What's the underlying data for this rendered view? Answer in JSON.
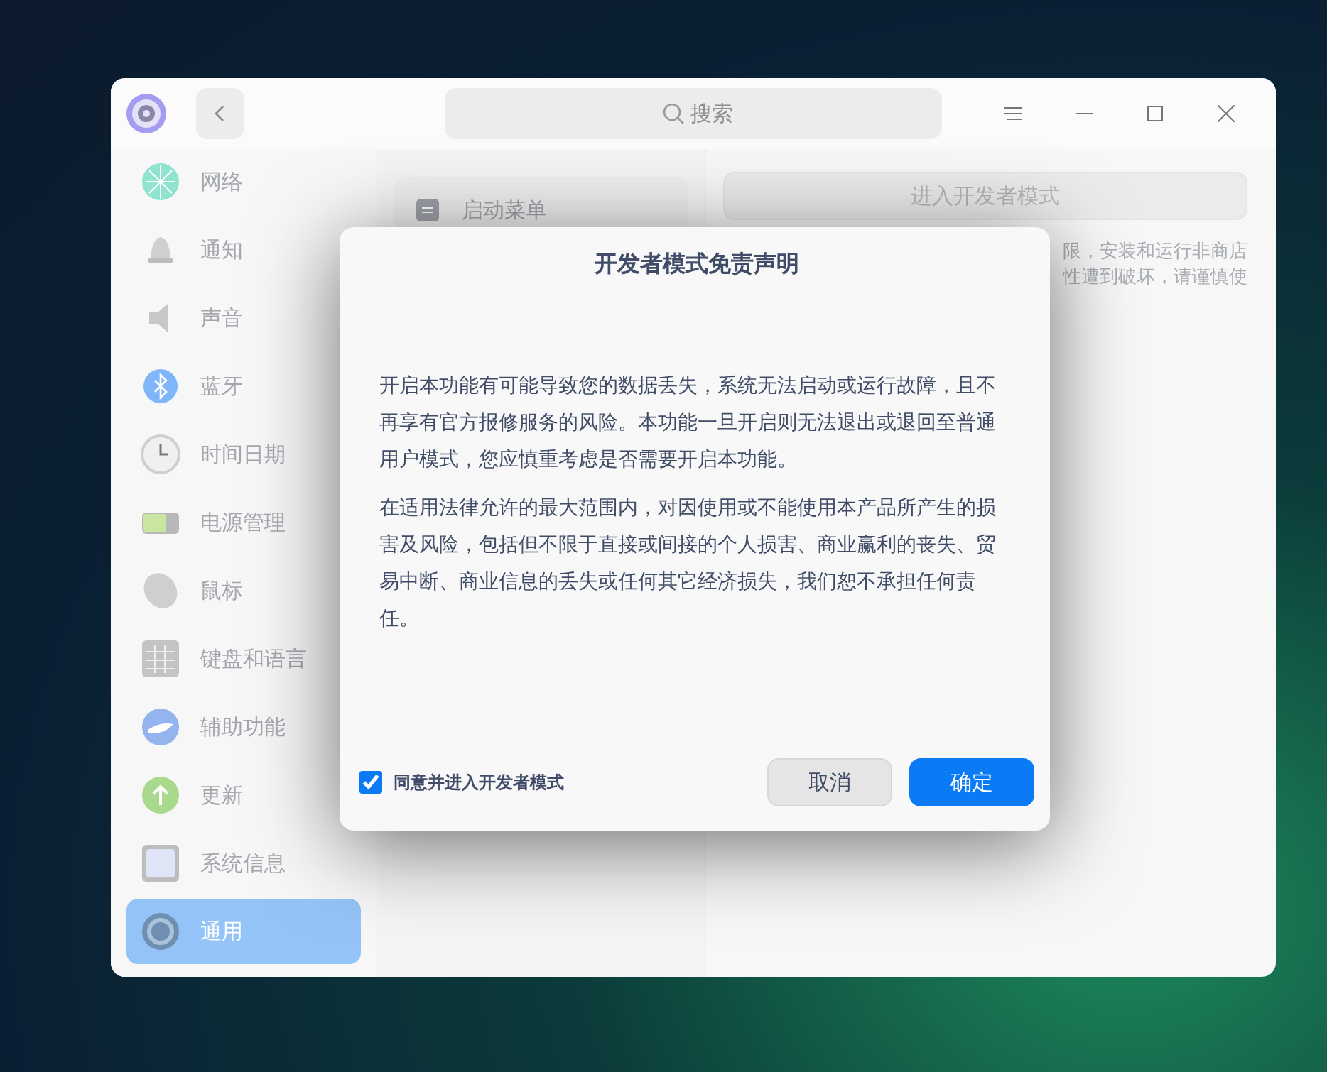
{
  "window": {
    "search": {
      "placeholder": "搜索"
    }
  },
  "sidebar": {
    "items": [
      {
        "label": "网络",
        "selected": false
      },
      {
        "label": "通知",
        "selected": false
      },
      {
        "label": "声音",
        "selected": false
      },
      {
        "label": "蓝牙",
        "selected": false
      },
      {
        "label": "时间日期",
        "selected": false
      },
      {
        "label": "电源管理",
        "selected": false
      },
      {
        "label": "鼠标",
        "selected": false
      },
      {
        "label": "键盘和语言",
        "selected": false
      },
      {
        "label": "辅助功能",
        "selected": false
      },
      {
        "label": "更新",
        "selected": false
      },
      {
        "label": "系统信息",
        "selected": false
      },
      {
        "label": "通用",
        "selected": true
      }
    ]
  },
  "middle_panel": {
    "items": [
      {
        "label": "启动菜单"
      }
    ]
  },
  "developer_panel": {
    "button": "进入开发者模式",
    "description_lines": [
      "限，安装和运行非商店",
      "性遭到破坏，请谨慎使"
    ]
  },
  "dialog": {
    "title": "开发者模式免责声明",
    "paragraphs": [
      "开启本功能有可能导致您的数据丢失，系统无法启动或运行故障，且不再享有官方报修服务的风险。本功能一旦开启则无法退出或退回至普通用户模式，您应慎重考虑是否需要开启本功能。",
      "在适用法律允许的最大范围内，对因使用或不能使用本产品所产生的损害及风险，包括但不限于直接或间接的个人损害、商业赢利的丧失、贸易中断、商业信息的丢失或任何其它经济损失，我们恕不承担任何责任。"
    ],
    "agree": {
      "label": "同意并进入开发者模式",
      "checked": true
    },
    "buttons": [
      {
        "label": "取消",
        "kind": "secondary"
      },
      {
        "label": "确定",
        "kind": "primary"
      }
    ]
  }
}
